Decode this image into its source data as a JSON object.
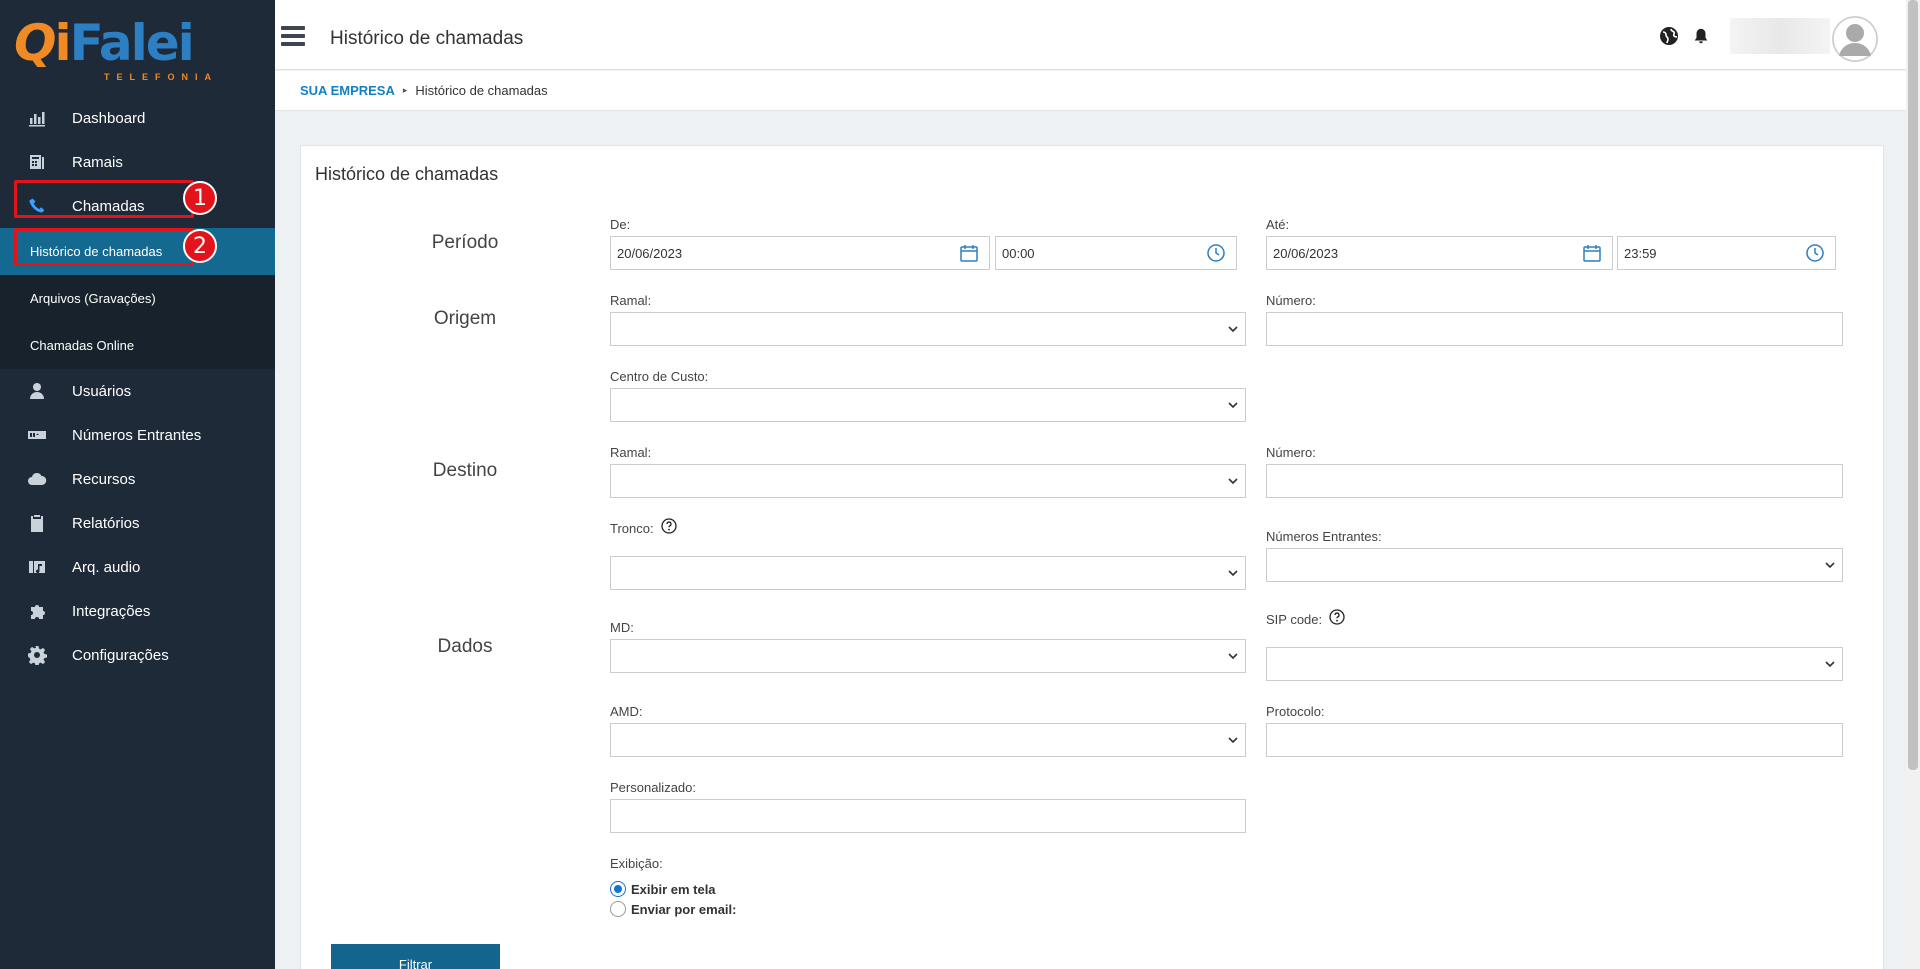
{
  "logo": {
    "brand": "iFalei",
    "subtitle": "TELEFONIA"
  },
  "sidebar": {
    "items": [
      {
        "label": "Dashboard",
        "icon": "dashboard-chart-icon"
      },
      {
        "label": "Ramais",
        "icon": "extensions-icon"
      },
      {
        "label": "Chamadas",
        "icon": "phone-icon"
      },
      {
        "label": "Usuários",
        "icon": "user-icon"
      },
      {
        "label": "Números Entrantes",
        "icon": "incoming-numbers-icon"
      },
      {
        "label": "Recursos",
        "icon": "cloud-icon"
      },
      {
        "label": "Relatórios",
        "icon": "clipboard-icon"
      },
      {
        "label": "Arq. audio",
        "icon": "audio-file-icon"
      },
      {
        "label": "Integrações",
        "icon": "puzzle-icon"
      },
      {
        "label": "Configurações",
        "icon": "gear-icon"
      }
    ],
    "submenu": [
      {
        "label": "Histórico de chamadas"
      },
      {
        "label": "Arquivos (Gravações)"
      },
      {
        "label": "Chamadas Online"
      }
    ],
    "annotations": [
      "1",
      "2"
    ]
  },
  "header": {
    "title": "Histórico de chamadas"
  },
  "breadcrumb": {
    "root": "SUA EMPRESA",
    "current": "Histórico de chamadas"
  },
  "form": {
    "title": "Histórico de chamadas",
    "sections": {
      "periodo": "Período",
      "origem": "Origem",
      "destino": "Destino",
      "dados": "Dados"
    },
    "periodo": {
      "de_label": "De:",
      "de_date": "20/06/2023",
      "de_time": "00:00",
      "ate_label": "Até:",
      "ate_date": "20/06/2023",
      "ate_time": "23:59"
    },
    "origem": {
      "ramal_label": "Ramal:",
      "numero_label": "Número:",
      "centro_label": "Centro de Custo:"
    },
    "destino": {
      "ramal_label": "Ramal:",
      "numero_label": "Número:",
      "tronco_label": "Tronco:",
      "entrantes_label": "Números Entrantes:"
    },
    "dados": {
      "md_label": "MD:",
      "sip_label": "SIP code:",
      "amd_label": "AMD:",
      "protocolo_label": "Protocolo:",
      "personalizado_label": "Personalizado:"
    },
    "exibicao": {
      "label": "Exibição:",
      "options": [
        "Exibir em tela",
        "Enviar por email:"
      ],
      "selected": "Exibir em tela"
    },
    "submit_label": "Filtrar"
  },
  "colors": {
    "sidebar": "#1e2a38",
    "active": "#13698f",
    "accent": "#1380c4",
    "annotation": "#e3131b"
  }
}
